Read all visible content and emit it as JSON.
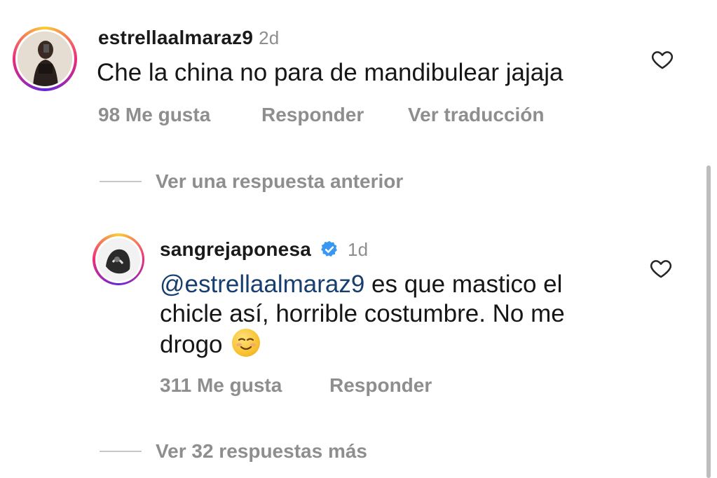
{
  "comments": [
    {
      "username": "estrellaalmaraz9",
      "time": "2d",
      "text": "Che la china no para de mandibulear jajaja",
      "likes": "98 Me gusta",
      "reply_label": "Responder",
      "translate_label": "Ver traducción",
      "heart_icon": "heart-outline-icon"
    },
    {
      "username": "sangrejaponesa",
      "verified": true,
      "time": "1d",
      "mention": "@estrellaalmaraz9",
      "text_line1_rest": " es que mastico el",
      "text_line2": "chicle así, horrible costumbre. No me",
      "text_line3": "drogo",
      "emoji": "smiling-face-icon",
      "likes": "311 Me gusta",
      "reply_label": "Responder",
      "heart_icon": "heart-outline-icon"
    }
  ],
  "previous_reply_label": "Ver una respuesta anterior",
  "more_replies_label": "Ver 32 respuestas más",
  "colors": {
    "meta_gray": "#8e8e8e",
    "mention_blue": "#163e6e",
    "verified_blue": "#3897f0"
  }
}
